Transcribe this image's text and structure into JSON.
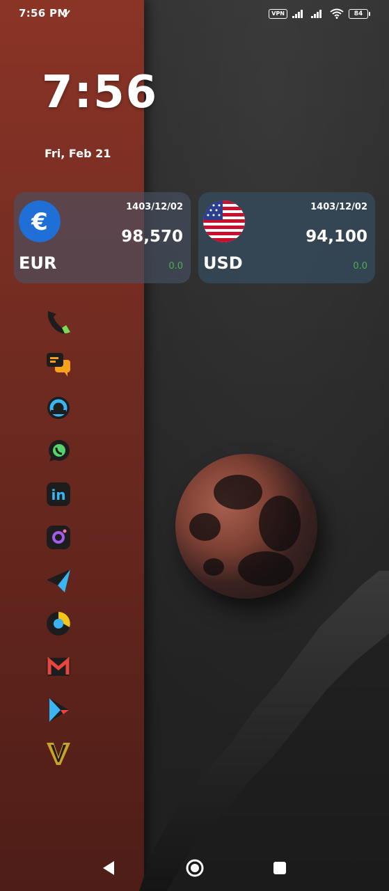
{
  "status_bar": {
    "time": "7:56 PM",
    "vpn": "VPN",
    "battery": "84"
  },
  "clock": {
    "time": "7:56",
    "date": "Fri, Feb 21"
  },
  "widgets": [
    {
      "code": "EUR",
      "date": "1403/12/02",
      "rate": "98,570",
      "change": "0.0",
      "icon": "euro-icon"
    },
    {
      "code": "USD",
      "date": "1403/12/02",
      "rate": "94,100",
      "change": "0.0",
      "icon": "us-flag-icon"
    }
  ],
  "apps": [
    {
      "name": "phone",
      "icon": "phone-icon"
    },
    {
      "name": "messages",
      "icon": "chat-icon"
    },
    {
      "name": "app-circle",
      "icon": "ring-icon"
    },
    {
      "name": "whatsapp",
      "icon": "whatsapp-icon"
    },
    {
      "name": "linkedin",
      "icon": "linkedin-icon"
    },
    {
      "name": "instagram",
      "icon": "instagram-icon"
    },
    {
      "name": "telegram",
      "icon": "telegram-icon"
    },
    {
      "name": "chrome",
      "icon": "chrome-icon"
    },
    {
      "name": "gmail",
      "icon": "gmail-icon"
    },
    {
      "name": "play-store",
      "icon": "play-store-icon"
    },
    {
      "name": "v-app",
      "icon": "v-logo-icon"
    }
  ],
  "nav": {
    "back": "back-icon",
    "home": "home-icon",
    "recents": "recents-icon"
  },
  "colors": {
    "accent_green": "#4caf50",
    "panel_red": "#7a2f24"
  }
}
